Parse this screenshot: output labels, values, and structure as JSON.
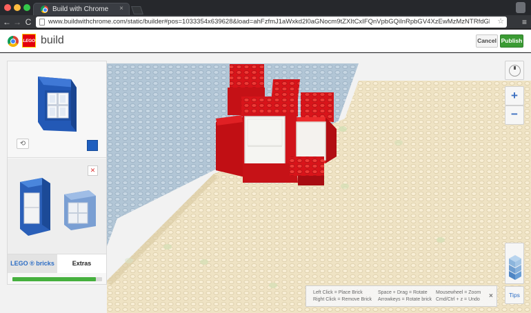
{
  "browser": {
    "tab_title": "Build with Chrome",
    "url": "www.buildwithchrome.com/static/builder#pos=1033354x639628&load=ahFzfmJ1aWxkd2l0aGNocm9tZXItCxIFQnVpbGQiInRpbGV4XzEwMzMzNTRfdGlsZXlfNjM5NjI4X3pvb21fMj…",
    "back": "←",
    "forward": "→",
    "reload": "C",
    "menu": "≡",
    "star": "☆",
    "close": "×"
  },
  "header": {
    "lego_logo": "LEGO",
    "title": "build",
    "cancel_label": "Cancel",
    "publish_label": "Publish"
  },
  "panel": {
    "rotate_icon": "rotate-icon",
    "tabs": [
      "LEGO ® bricks",
      "Extras"
    ],
    "progress": 0.93
  },
  "controls": {
    "zoom_in": "+",
    "zoom_out": "−",
    "tips_label": "Tips"
  },
  "help": {
    "col1": [
      "Left Click = Place Brick",
      "Right Click = Remove Brick"
    ],
    "col2": [
      "Space + Drag = Rotate",
      "Arrowkeys = Rotate brick"
    ],
    "col3": [
      "Mousewheel = Zoom",
      "Cmd/Ctrl + z = Undo"
    ],
    "close": "×"
  },
  "colors": {
    "accent": "#3b9b34",
    "brick_red": "#d8141a",
    "brick_blue": "#1f5fbf",
    "baseplate_cream": "#efe4c6",
    "baseplate_blue": "#b5c8d6"
  }
}
